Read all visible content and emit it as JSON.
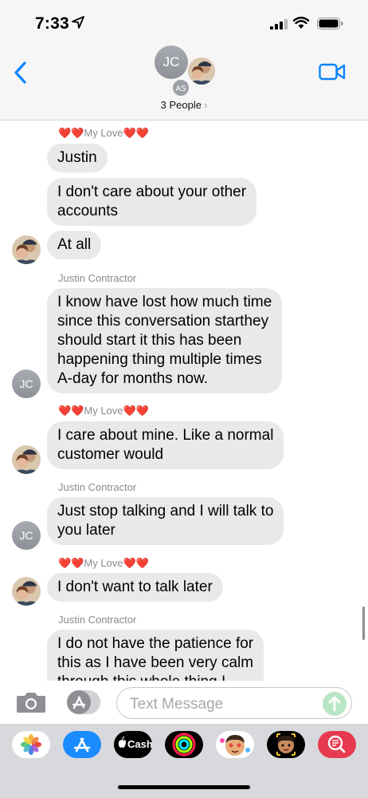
{
  "status_bar": {
    "time": "7:33"
  },
  "header": {
    "group_avatar_initials": "JC",
    "member_avatar_initials": "AS",
    "participants_label": "3 People",
    "chevron": "›"
  },
  "senders": {
    "my_love": "❤️❤️My Love❤️❤️",
    "justin": "Justin Contractor"
  },
  "avatars": {
    "jc_initials": "JC"
  },
  "messages": [
    {
      "sender_label": "❤️❤️My Love❤️❤️",
      "lines": [
        "Justin"
      ]
    },
    {
      "lines": [
        "I don't care about your other",
        "accounts"
      ]
    },
    {
      "lines": [
        "At all"
      ]
    },
    {
      "sender_label": "Justin Contractor",
      "lines": [
        "I know have lost how much time",
        "since this conversation starthey",
        "should start it this has been",
        "happening thing multiple times",
        "A-day for months now."
      ]
    },
    {
      "sender_label": "❤️❤️My Love❤️❤️",
      "lines": [
        "I care about mine. Like a normal",
        "customer would"
      ]
    },
    {
      "sender_label": "Justin Contractor",
      "lines": [
        "Just stop talking and I will talk to",
        "you later"
      ]
    },
    {
      "sender_label": "❤️❤️My Love❤️❤️",
      "lines": [
        "I don't want to talk later"
      ]
    },
    {
      "sender_label": "Justin Contractor",
      "lines": [
        "I do not have the patience for",
        "this as I have been very calm",
        "through this whole thing I"
      ]
    }
  ],
  "input": {
    "placeholder": "Text Message"
  },
  "app_drawer": {
    "apps": [
      {
        "name": "photos-app",
        "icon": "photos-icon"
      },
      {
        "name": "app-store-app",
        "icon": "app-store-icon"
      },
      {
        "name": "apple-cash-app",
        "icon": "cash-icon",
        "label": "Cash"
      },
      {
        "name": "fitness-app",
        "icon": "activity-rings-icon"
      },
      {
        "name": "memoji-stickers-app",
        "icon": "memoji-icon"
      },
      {
        "name": "animoji-app",
        "icon": "animoji-icon"
      },
      {
        "name": "search-images-app",
        "icon": "image-search-icon"
      }
    ]
  },
  "colors": {
    "bubble_gray": "#e9e9eb",
    "ios_blue": "#0a84ff",
    "sender_gray": "#8a8a8e"
  }
}
